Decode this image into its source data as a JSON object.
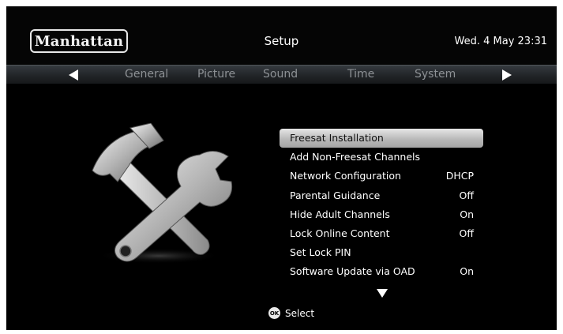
{
  "header": {
    "logo": "Manhattan",
    "title": "Setup",
    "datetime": "Wed. 4 May  23:31"
  },
  "tabs": [
    {
      "label": "General"
    },
    {
      "label": "Picture"
    },
    {
      "label": "Sound"
    },
    {
      "label": "Time"
    },
    {
      "label": "System"
    }
  ],
  "icons": {
    "tab_prev": "left-arrow-icon",
    "tab_next": "right-arrow-icon",
    "scroll_more": "down-arrow-icon",
    "illustration": "hammer-and-wrench-icon",
    "ok_button": "ok-button-icon"
  },
  "menu": {
    "items": [
      {
        "label": "Freesat Installation",
        "value": ""
      },
      {
        "label": "Add Non-Freesat Channels",
        "value": ""
      },
      {
        "label": "Network Configuration",
        "value": "DHCP"
      },
      {
        "label": "Parental Guidance",
        "value": "Off"
      },
      {
        "label": "Hide Adult Channels",
        "value": "On"
      },
      {
        "label": "Lock Online Content",
        "value": "Off"
      },
      {
        "label": "Set Lock PIN",
        "value": ""
      },
      {
        "label": "Software Update via OAD",
        "value": "On"
      }
    ]
  },
  "footer": {
    "ok_label": "OK",
    "hint": "Select"
  },
  "colors": {
    "background": "#000000",
    "text": "#ffffff",
    "tab_text": "#8d9195",
    "selection": "#c8c8c8"
  }
}
